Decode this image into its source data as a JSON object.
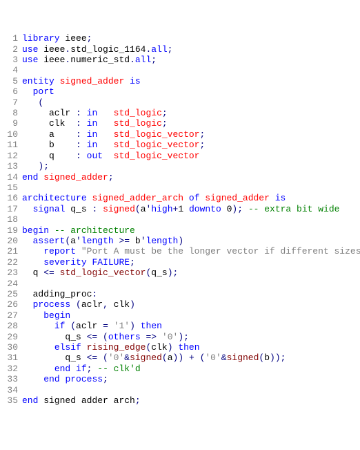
{
  "lines": [
    {
      "n": 1,
      "tokens": [
        [
          "kw",
          "library"
        ],
        [
          "",
          " ieee"
        ],
        [
          "op",
          ";"
        ]
      ]
    },
    {
      "n": 2,
      "tokens": [
        [
          "kw",
          "use"
        ],
        [
          "",
          " ieee"
        ],
        [
          "op",
          "."
        ],
        [
          "",
          "std_logic_1164"
        ],
        [
          "op",
          "."
        ],
        [
          "kw",
          "all"
        ],
        [
          "op",
          ";"
        ]
      ]
    },
    {
      "n": 3,
      "tokens": [
        [
          "kw",
          "use"
        ],
        [
          "",
          " ieee"
        ],
        [
          "op",
          "."
        ],
        [
          "",
          "numeric_std"
        ],
        [
          "op",
          "."
        ],
        [
          "kw",
          "all"
        ],
        [
          "op",
          ";"
        ]
      ]
    },
    {
      "n": 4,
      "tokens": []
    },
    {
      "n": 5,
      "tokens": [
        [
          "kw",
          "entity"
        ],
        [
          "",
          " "
        ],
        [
          "ty",
          "signed_adder"
        ],
        [
          "",
          " "
        ],
        [
          "kw",
          "is"
        ]
      ]
    },
    {
      "n": 6,
      "tokens": [
        [
          "",
          "  "
        ],
        [
          "kw",
          "port"
        ]
      ]
    },
    {
      "n": 7,
      "tokens": [
        [
          "",
          "   "
        ],
        [
          "op",
          "("
        ]
      ]
    },
    {
      "n": 8,
      "tokens": [
        [
          "",
          "     aclr "
        ],
        [
          "op",
          ":"
        ],
        [
          "",
          " "
        ],
        [
          "kw",
          "in"
        ],
        [
          "",
          "   "
        ],
        [
          "ty",
          "std_logic"
        ],
        [
          "op",
          ";"
        ]
      ]
    },
    {
      "n": 9,
      "tokens": [
        [
          "",
          "     clk  "
        ],
        [
          "op",
          ":"
        ],
        [
          "",
          " "
        ],
        [
          "kw",
          "in"
        ],
        [
          "",
          "   "
        ],
        [
          "ty",
          "std_logic"
        ],
        [
          "op",
          ";"
        ]
      ]
    },
    {
      "n": 10,
      "tokens": [
        [
          "",
          "     a    "
        ],
        [
          "op",
          ":"
        ],
        [
          "",
          " "
        ],
        [
          "kw",
          "in"
        ],
        [
          "",
          "   "
        ],
        [
          "ty",
          "std_logic_vector"
        ],
        [
          "op",
          ";"
        ]
      ]
    },
    {
      "n": 11,
      "tokens": [
        [
          "",
          "     b    "
        ],
        [
          "op",
          ":"
        ],
        [
          "",
          " "
        ],
        [
          "kw",
          "in"
        ],
        [
          "",
          "   "
        ],
        [
          "ty",
          "std_logic_vector"
        ],
        [
          "op",
          ";"
        ]
      ]
    },
    {
      "n": 12,
      "tokens": [
        [
          "",
          "     q    "
        ],
        [
          "op",
          ":"
        ],
        [
          "",
          " "
        ],
        [
          "kw",
          "out"
        ],
        [
          "",
          "  "
        ],
        [
          "ty",
          "std_logic_vector"
        ]
      ]
    },
    {
      "n": 13,
      "tokens": [
        [
          "",
          "   "
        ],
        [
          "op",
          ")"
        ],
        [
          "op",
          ";"
        ]
      ]
    },
    {
      "n": 14,
      "tokens": [
        [
          "kw",
          "end"
        ],
        [
          "",
          " "
        ],
        [
          "ty",
          "signed_adder"
        ],
        [
          "op",
          ";"
        ]
      ]
    },
    {
      "n": 15,
      "tokens": []
    },
    {
      "n": 16,
      "tokens": [
        [
          "kw",
          "architecture"
        ],
        [
          "",
          " "
        ],
        [
          "ty",
          "signed_adder_arch"
        ],
        [
          "",
          " "
        ],
        [
          "kw",
          "of"
        ],
        [
          "",
          " "
        ],
        [
          "ty",
          "signed_adder"
        ],
        [
          "",
          " "
        ],
        [
          "kw",
          "is"
        ]
      ]
    },
    {
      "n": 17,
      "tokens": [
        [
          "",
          "  "
        ],
        [
          "kw",
          "signal"
        ],
        [
          "",
          " q_s "
        ],
        [
          "op",
          ":"
        ],
        [
          "",
          " "
        ],
        [
          "ty",
          "signed"
        ],
        [
          "op",
          "("
        ],
        [
          "",
          "a"
        ],
        [
          "op",
          "'"
        ],
        [
          "kw",
          "high"
        ],
        [
          "op",
          "+"
        ],
        [
          "",
          "1 "
        ],
        [
          "kw",
          "downto"
        ],
        [
          "",
          " 0"
        ],
        [
          "op",
          ")"
        ],
        [
          "op",
          ";"
        ],
        [
          "",
          " "
        ],
        [
          "cm",
          "-- extra bit wide"
        ]
      ]
    },
    {
      "n": 18,
      "tokens": []
    },
    {
      "n": 19,
      "tokens": [
        [
          "kw",
          "begin"
        ],
        [
          "",
          " "
        ],
        [
          "cm",
          "-- architecture"
        ]
      ]
    },
    {
      "n": 20,
      "tokens": [
        [
          "",
          "  "
        ],
        [
          "kw",
          "assert"
        ],
        [
          "op",
          "("
        ],
        [
          "",
          "a"
        ],
        [
          "op",
          "'"
        ],
        [
          "kw",
          "length"
        ],
        [
          "",
          " "
        ],
        [
          "op",
          ">="
        ],
        [
          "",
          " b"
        ],
        [
          "op",
          "'"
        ],
        [
          "kw",
          "length"
        ],
        [
          "op",
          ")"
        ]
      ]
    },
    {
      "n": 21,
      "tokens": [
        [
          "",
          "    "
        ],
        [
          "kw",
          "report"
        ],
        [
          "",
          " "
        ],
        [
          "str",
          "\"Port A must be the longer vector if different sizes!\""
        ]
      ]
    },
    {
      "n": 22,
      "tokens": [
        [
          "",
          "    "
        ],
        [
          "kw",
          "severity"
        ],
        [
          "",
          " "
        ],
        [
          "kw",
          "FAILURE"
        ],
        [
          "op",
          ";"
        ]
      ]
    },
    {
      "n": 23,
      "tokens": [
        [
          "",
          "  q "
        ],
        [
          "op",
          "<="
        ],
        [
          "",
          " "
        ],
        [
          "fn",
          "std_logic_vector"
        ],
        [
          "op",
          "("
        ],
        [
          "",
          "q_s"
        ],
        [
          "op",
          ")"
        ],
        [
          "op",
          ";"
        ]
      ]
    },
    {
      "n": 24,
      "tokens": []
    },
    {
      "n": 25,
      "tokens": [
        [
          "",
          "  adding_proc"
        ],
        [
          "op",
          ":"
        ]
      ]
    },
    {
      "n": 26,
      "tokens": [
        [
          "",
          "  "
        ],
        [
          "kw",
          "process"
        ],
        [
          "",
          " "
        ],
        [
          "op",
          "("
        ],
        [
          "",
          "aclr"
        ],
        [
          "op",
          ","
        ],
        [
          "",
          " clk"
        ],
        [
          "op",
          ")"
        ]
      ]
    },
    {
      "n": 27,
      "tokens": [
        [
          "",
          "    "
        ],
        [
          "kw",
          "begin"
        ]
      ]
    },
    {
      "n": 28,
      "tokens": [
        [
          "",
          "      "
        ],
        [
          "kw",
          "if"
        ],
        [
          "",
          " "
        ],
        [
          "op",
          "("
        ],
        [
          "",
          "aclr "
        ],
        [
          "op",
          "="
        ],
        [
          "",
          " "
        ],
        [
          "str",
          "'1'"
        ],
        [
          "op",
          ")"
        ],
        [
          "",
          " "
        ],
        [
          "kw",
          "then"
        ]
      ]
    },
    {
      "n": 29,
      "tokens": [
        [
          "",
          "        q_s "
        ],
        [
          "op",
          "<="
        ],
        [
          "",
          " "
        ],
        [
          "op",
          "("
        ],
        [
          "kw",
          "others"
        ],
        [
          "",
          " "
        ],
        [
          "op",
          "=>"
        ],
        [
          "",
          " "
        ],
        [
          "str",
          "'0'"
        ],
        [
          "op",
          ")"
        ],
        [
          "op",
          ";"
        ]
      ]
    },
    {
      "n": 30,
      "tokens": [
        [
          "",
          "      "
        ],
        [
          "kw",
          "elsif"
        ],
        [
          "",
          " "
        ],
        [
          "fn",
          "rising_edge"
        ],
        [
          "op",
          "("
        ],
        [
          "",
          "clk"
        ],
        [
          "op",
          ")"
        ],
        [
          "",
          " "
        ],
        [
          "kw",
          "then"
        ]
      ]
    },
    {
      "n": 31,
      "tokens": [
        [
          "",
          "        q_s "
        ],
        [
          "op",
          "<="
        ],
        [
          "",
          " "
        ],
        [
          "op",
          "("
        ],
        [
          "str",
          "'0'"
        ],
        [
          "op",
          "&"
        ],
        [
          "fn",
          "signed"
        ],
        [
          "op",
          "("
        ],
        [
          "",
          "a"
        ],
        [
          "op",
          "))"
        ],
        [
          "",
          " "
        ],
        [
          "op",
          "+"
        ],
        [
          "",
          " "
        ],
        [
          "op",
          "("
        ],
        [
          "str",
          "'0'"
        ],
        [
          "op",
          "&"
        ],
        [
          "fn",
          "signed"
        ],
        [
          "op",
          "("
        ],
        [
          "",
          "b"
        ],
        [
          "op",
          "));"
        ]
      ]
    },
    {
      "n": 32,
      "tokens": [
        [
          "",
          "      "
        ],
        [
          "kw",
          "end"
        ],
        [
          "",
          " "
        ],
        [
          "kw",
          "if"
        ],
        [
          "op",
          ";"
        ],
        [
          "",
          " "
        ],
        [
          "cm",
          "-- clk'd"
        ]
      ]
    },
    {
      "n": 33,
      "tokens": [
        [
          "",
          "    "
        ],
        [
          "kw",
          "end"
        ],
        [
          "",
          " "
        ],
        [
          "kw",
          "process"
        ],
        [
          "op",
          ";"
        ]
      ]
    },
    {
      "n": 34,
      "tokens": []
    },
    {
      "n": 35,
      "tokens": [
        [
          "kw",
          "end"
        ],
        [
          "",
          " signed adder arch"
        ],
        [
          "op",
          ";"
        ]
      ]
    }
  ]
}
